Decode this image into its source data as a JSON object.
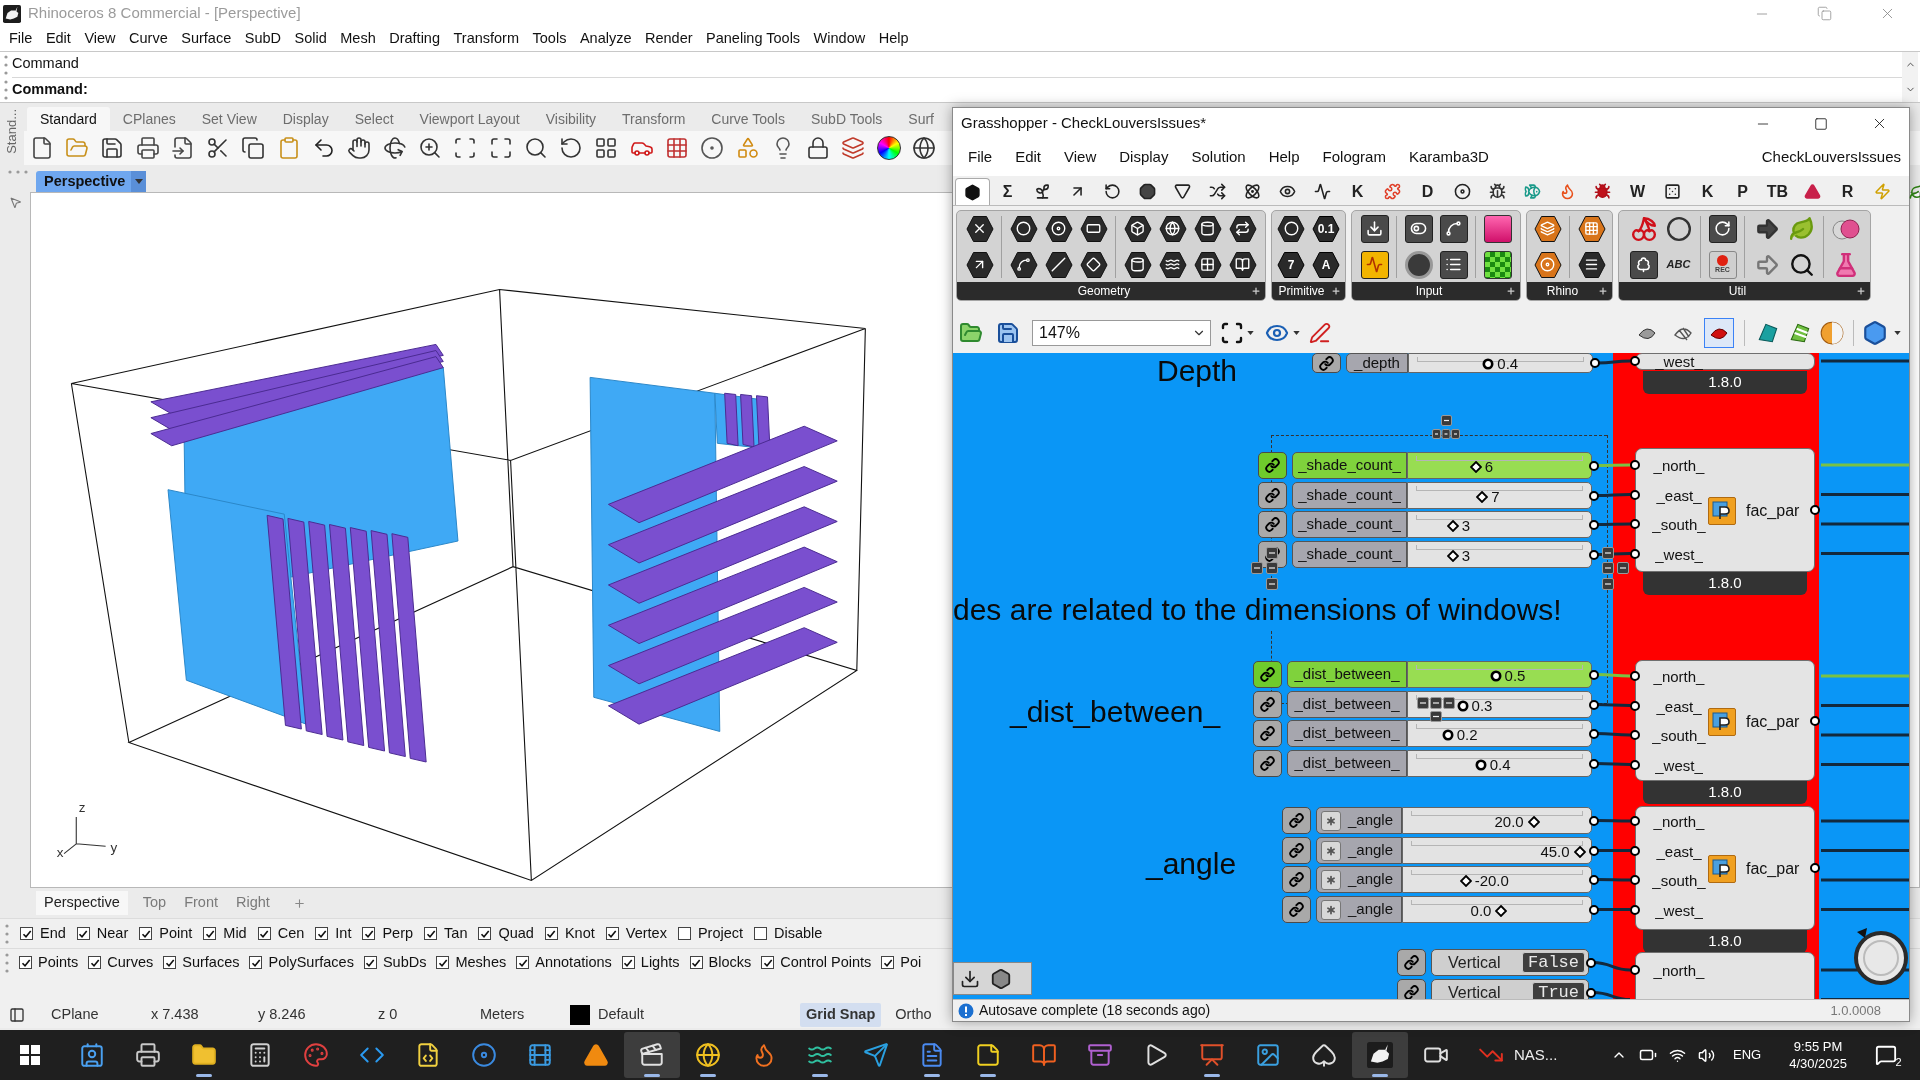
{
  "rhino": {
    "title": "Rhinoceros 8 Commercial - [Perspective]",
    "menu": [
      "File",
      "Edit",
      "View",
      "Curve",
      "Surface",
      "SubD",
      "Solid",
      "Mesh",
      "Drafting",
      "Transform",
      "Tools",
      "Analyze",
      "Render",
      "Paneling Tools",
      "Window",
      "Help"
    ],
    "command_history": [
      "Command"
    ],
    "command_prompt": "Command:",
    "toolbar_group": "Stand...",
    "toolbar_tabs": [
      {
        "label": "Standard",
        "selected": true
      },
      {
        "label": "CPlanes",
        "selected": false
      },
      {
        "label": "Set View",
        "selected": false
      },
      {
        "label": "Display",
        "selected": false
      },
      {
        "label": "Select",
        "selected": false
      },
      {
        "label": "Viewport Layout",
        "selected": false
      },
      {
        "label": "Visibility",
        "selected": false
      },
      {
        "label": "Transform",
        "selected": false
      },
      {
        "label": "Curve Tools",
        "selected": false
      },
      {
        "label": "SubD Tools",
        "selected": false
      },
      {
        "label": "Surf",
        "selected": false
      }
    ],
    "viewport_title": "Perspective",
    "axis_labels": [
      "z",
      "x",
      "y"
    ],
    "viewport_tabs": [
      {
        "label": "Perspective",
        "selected": true
      },
      {
        "label": "Top",
        "selected": false
      },
      {
        "label": "Front",
        "selected": false
      },
      {
        "label": "Right",
        "selected": false
      }
    ],
    "osnaps": [
      {
        "label": "End",
        "checked": true
      },
      {
        "label": "Near",
        "checked": true
      },
      {
        "label": "Point",
        "checked": true
      },
      {
        "label": "Mid",
        "checked": true
      },
      {
        "label": "Cen",
        "checked": true
      },
      {
        "label": "Int",
        "checked": true
      },
      {
        "label": "Perp",
        "checked": true
      },
      {
        "label": "Tan",
        "checked": true
      },
      {
        "label": "Quad",
        "checked": true
      },
      {
        "label": "Knot",
        "checked": true
      },
      {
        "label": "Vertex",
        "checked": true
      },
      {
        "label": "Project",
        "checked": false
      },
      {
        "label": "Disable",
        "checked": false
      }
    ],
    "filters": [
      {
        "label": "Points",
        "checked": true
      },
      {
        "label": "Curves",
        "checked": true
      },
      {
        "label": "Surfaces",
        "checked": true
      },
      {
        "label": "PolySurfaces",
        "checked": true
      },
      {
        "label": "SubDs",
        "checked": true
      },
      {
        "label": "Meshes",
        "checked": true
      },
      {
        "label": "Annotations",
        "checked": true
      },
      {
        "label": "Lights",
        "checked": true
      },
      {
        "label": "Blocks",
        "checked": true
      },
      {
        "label": "Control Points",
        "checked": true
      },
      {
        "label": "Poi",
        "checked": true
      }
    ],
    "status_bar": {
      "cplane": "CPlane",
      "x": "x 7.438",
      "y": "y 8.246",
      "z": "z 0",
      "units": "Meters",
      "layer": {
        "label": "Default",
        "color": "#000000"
      },
      "grid_snap": {
        "label": "Grid Snap",
        "on": true
      },
      "ortho": {
        "label": "Ortho",
        "on": false
      }
    }
  },
  "grasshopper": {
    "title": "Grasshopper - CheckLouversIssues*",
    "menu": [
      "File",
      "Edit",
      "View",
      "Display",
      "Solution",
      "Help",
      "Fologram",
      "Karamba3D"
    ],
    "document": "CheckLouversIssues",
    "ribbon_tabs": [
      {
        "kind": "icon",
        "selected": true
      },
      {
        "kind": "letter",
        "label": "Σ",
        "selected": false
      },
      {
        "kind": "icon",
        "selected": false
      },
      {
        "kind": "icon",
        "selected": false
      },
      {
        "kind": "icon",
        "selected": false
      },
      {
        "kind": "icon",
        "selected": false
      },
      {
        "kind": "icon",
        "selected": false
      },
      {
        "kind": "icon",
        "selected": false
      },
      {
        "kind": "icon",
        "selected": false
      },
      {
        "kind": "icon",
        "selected": false
      },
      {
        "kind": "icon",
        "selected": false
      },
      {
        "kind": "letter",
        "label": "K",
        "selected": false
      },
      {
        "kind": "icon",
        "selected": false
      },
      {
        "kind": "letter",
        "label": "D",
        "selected": false
      },
      {
        "kind": "icon",
        "selected": false
      },
      {
        "kind": "icon",
        "selected": false
      },
      {
        "kind": "icon",
        "selected": false
      },
      {
        "kind": "icon",
        "selected": false
      },
      {
        "kind": "icon",
        "selected": false
      },
      {
        "kind": "letter",
        "label": "W",
        "selected": false
      },
      {
        "kind": "icon",
        "selected": false
      },
      {
        "kind": "letter",
        "label": "K",
        "selected": false
      },
      {
        "kind": "letter",
        "label": "P",
        "selected": false
      },
      {
        "kind": "letter",
        "label": "TB",
        "selected": false
      },
      {
        "kind": "icon",
        "selected": false
      },
      {
        "kind": "letter",
        "label": "R",
        "selected": false
      },
      {
        "kind": "icon",
        "selected": false
      },
      {
        "kind": "icon",
        "selected": false
      }
    ],
    "panels": [
      {
        "label": "Geometry"
      },
      {
        "label": "Primitive",
        "glyphs": [
          "0.1",
          "7",
          "A"
        ]
      },
      {
        "label": "Input"
      },
      {
        "label": "Rhino"
      },
      {
        "label": "Util",
        "glyphs": [
          "ABC",
          "REC"
        ]
      }
    ],
    "zoom": "147%",
    "preview_modes": [
      {
        "selected": false
      },
      {
        "selected": false
      },
      {
        "selected": true
      }
    ],
    "canvas": {
      "notes": [
        "Depth",
        "des are related to the dimensions of windows!",
        "_dist_between_",
        "_angle"
      ],
      "groups": [
        {
          "rows": [
            {
              "kind": "float",
              "name": "_depth",
              "value": "0.4",
              "level": 0.42,
              "selected": false
            }
          ],
          "component": {
            "inputs": [
              "_west_"
            ],
            "version": "1.8.0"
          }
        },
        {
          "rows": [
            {
              "kind": "integer",
              "name": "_shade_count_",
              "value": "6",
              "level": 0.35,
              "selected": true
            },
            {
              "kind": "integer",
              "name": "_shade_count_",
              "value": "7",
              "level": 0.39,
              "selected": false
            },
            {
              "kind": "integer",
              "name": "_shade_count_",
              "value": "3",
              "level": 0.21,
              "selected": false
            },
            {
              "kind": "integer",
              "name": "_shade_count_",
              "value": "3",
              "level": 0.21,
              "selected": false
            }
          ],
          "component": {
            "inputs": [
              "_north_",
              "_east_",
              "_south_",
              "_west_"
            ],
            "name": "fac_par",
            "version": "1.8.0"
          }
        },
        {
          "rows": [
            {
              "kind": "float",
              "name": "_dist_between_",
              "value": "0.5",
              "level": 0.47,
              "selected": true
            },
            {
              "kind": "float",
              "name": "_dist_between_",
              "value": "0.3",
              "level": 0.27,
              "selected": false
            },
            {
              "kind": "float",
              "name": "_dist_between_",
              "value": "0.2",
              "level": 0.18,
              "selected": false
            },
            {
              "kind": "float",
              "name": "_dist_between_",
              "value": "0.4",
              "level": 0.38,
              "selected": false
            }
          ],
          "component": {
            "inputs": [
              "_north_",
              "_east_",
              "_south_",
              "_west_"
            ],
            "name": "fac_par",
            "version": "1.8.0"
          }
        },
        {
          "rows": [
            {
              "kind": "expression",
              "name": "_angle",
              "value": "20.0",
              "level": 0.71,
              "selected": false
            },
            {
              "kind": "expression",
              "name": "_angle",
              "value": "45.0",
              "level": 0.98,
              "selected": false
            },
            {
              "kind": "expression",
              "name": "_angle",
              "value": "-20.0",
              "level": 0.31,
              "selected": false
            },
            {
              "kind": "expression",
              "name": "_angle",
              "value": "0.0",
              "level": 0.52,
              "selected": false
            }
          ],
          "component": {
            "inputs": [
              "_north_",
              "_east_",
              "_south_",
              "_west_"
            ],
            "name": "fac_par",
            "version": "1.8.0"
          }
        },
        {
          "rows": [
            {
              "kind": "toggle",
              "name": "Vertical",
              "value": "False"
            },
            {
              "kind": "toggle",
              "name": "Vertical",
              "value": "True"
            }
          ],
          "component": {
            "inputs": [
              "_north_"
            ]
          }
        }
      ]
    },
    "status": "Autosave complete (18 seconds ago)",
    "version": "1.0.0008"
  },
  "taskbar": {
    "apps": [
      {
        "running": false,
        "active": false
      },
      {
        "running": false,
        "active": false
      },
      {
        "running": true,
        "active": false
      },
      {
        "running": false,
        "active": false
      },
      {
        "running": false,
        "active": false
      },
      {
        "running": false,
        "active": false
      },
      {
        "running": false,
        "active": false
      },
      {
        "running": false,
        "active": false
      },
      {
        "running": false,
        "active": false
      },
      {
        "running": false,
        "active": false
      },
      {
        "running": true,
        "active": true
      },
      {
        "running": true,
        "active": false
      },
      {
        "running": false,
        "active": false
      },
      {
        "running": true,
        "active": false
      },
      {
        "running": false,
        "active": false
      },
      {
        "running": true,
        "active": false
      },
      {
        "running": true,
        "active": false
      },
      {
        "running": false,
        "active": false
      },
      {
        "running": false,
        "active": false
      },
      {
        "running": false,
        "active": false
      },
      {
        "running": true,
        "active": false
      },
      {
        "running": false,
        "active": false
      },
      {
        "running": false,
        "active": false
      },
      {
        "running": true,
        "active": true
      },
      {
        "running": false,
        "active": false
      },
      {
        "running": false,
        "active": false,
        "label": "NAS..."
      }
    ],
    "tray": {
      "language": "ENG",
      "time": "9:55 PM",
      "date": "4/30/2025",
      "notifications": "2"
    }
  }
}
